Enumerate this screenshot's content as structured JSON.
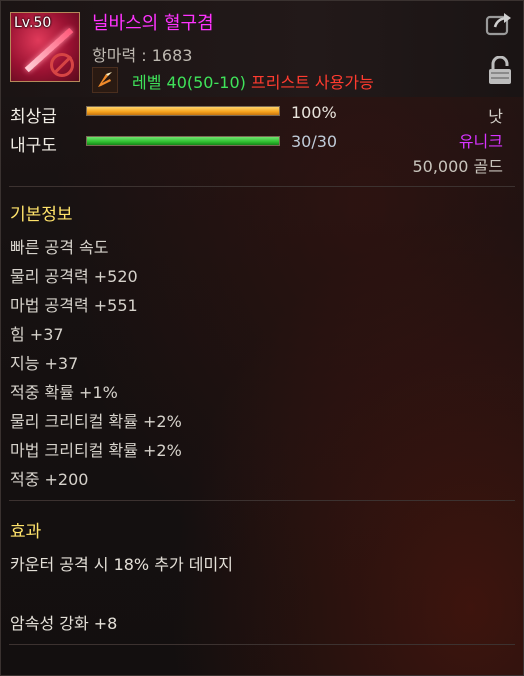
{
  "item": {
    "level": "Lv.50",
    "name": "닐바스의 혈구겸",
    "power": "항마력 : 1683",
    "requirement_level": "레벨 40(50-10)",
    "requirement_class": "프리스트 사용가능"
  },
  "grade": {
    "label": "최상급",
    "value": "100%",
    "fill_fraction": 1.0
  },
  "durability": {
    "label": "내구도",
    "value": "30/30",
    "fill_fraction": 1.0
  },
  "item_type": "낫",
  "rarity": "유니크",
  "price": "50,000 골드",
  "basic_info": {
    "title": "기본정보",
    "stats": [
      "빠른 공격 속도",
      "물리 공격력 +520",
      "마법 공격력 +551",
      "힘 +37",
      "지능 +37",
      "적중 확률 +1%",
      "물리 크리티컬 확률 +2%",
      "마법 크리티컬 확률 +2%",
      "적중 +200"
    ]
  },
  "effect": {
    "title": "효과",
    "lines": [
      "카운터 공격 시 18% 추가 데미지",
      "암속성 강화 +8"
    ]
  },
  "colors": {
    "name": "#ff33ff",
    "rarity": "#d633ff",
    "grade_bar": "#f5a21c",
    "durability_bar": "#2fbf2f",
    "section_title": "#ffe36b",
    "req_ok": "#3fe35a",
    "req_fail": "#ff3b2f"
  },
  "icons": {
    "weapon": "scythe-weapon-icon",
    "cannot_use": "prohibited-icon",
    "class": "priest-class-icon",
    "share": "share-icon",
    "lock": "lock-icon"
  }
}
